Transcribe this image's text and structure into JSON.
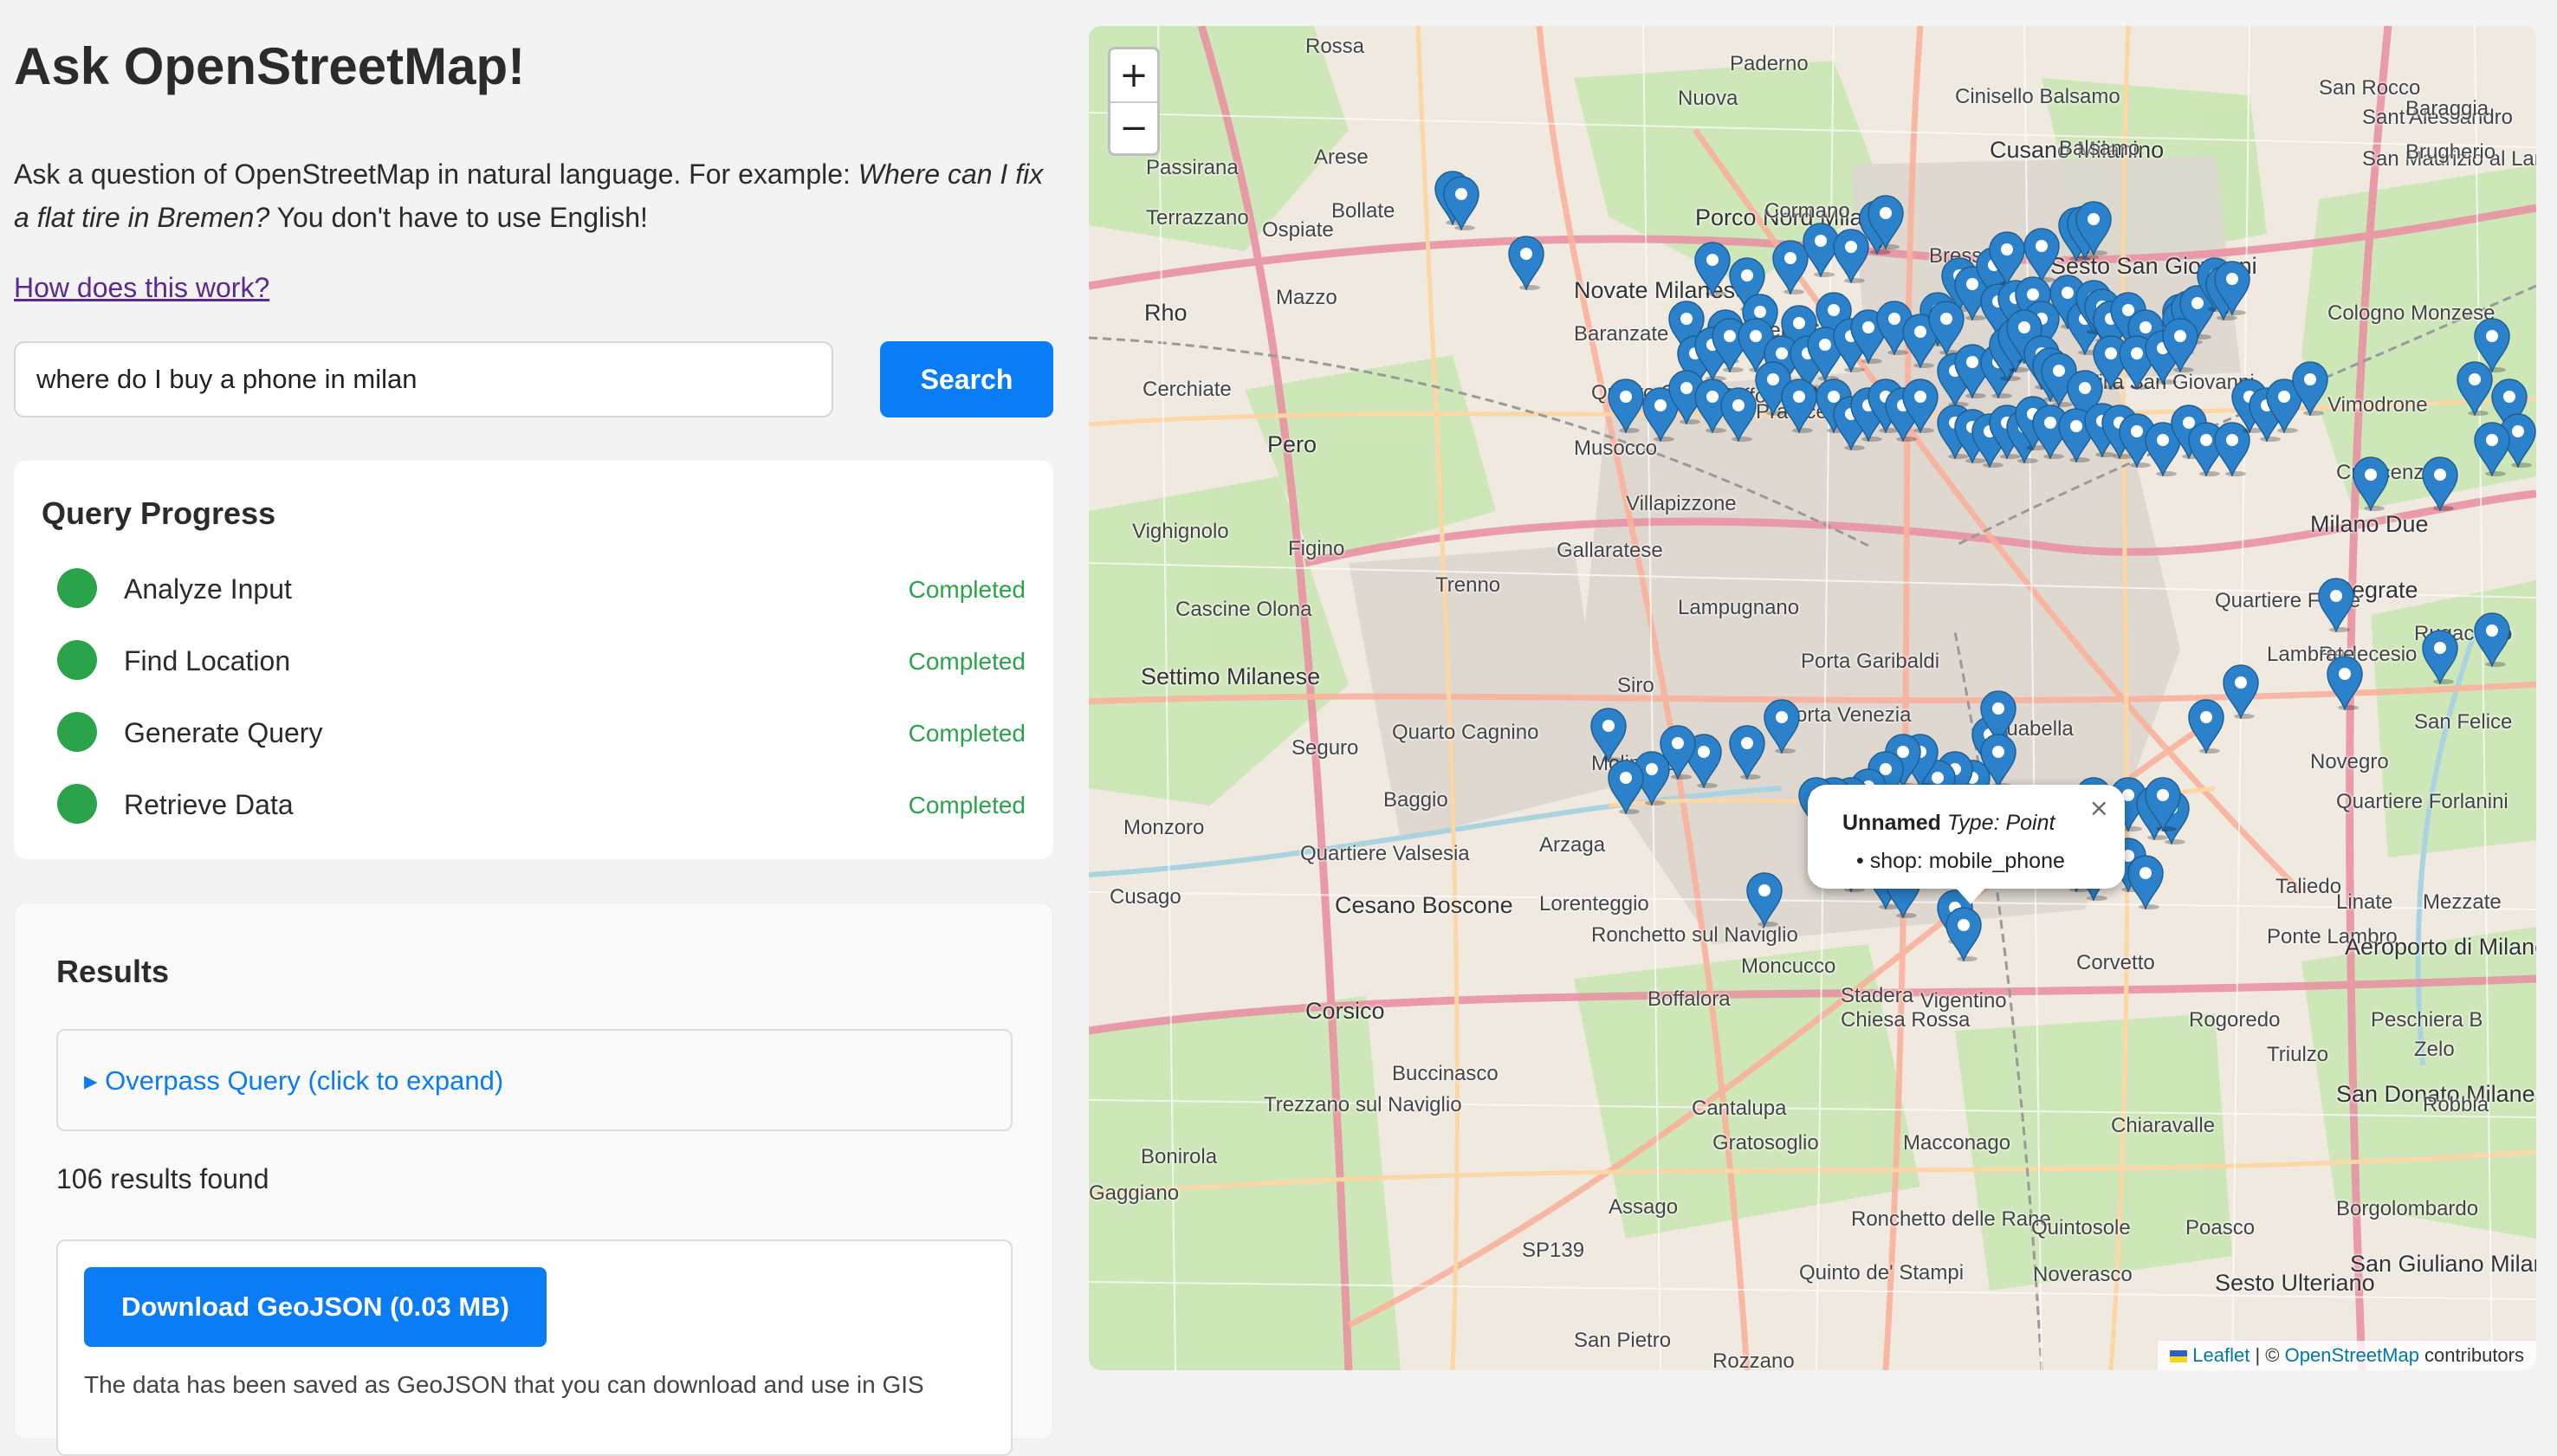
{
  "page": {
    "title": "Ask OpenStreetMap!",
    "intro_prefix": "Ask a question of OpenStreetMap in natural language. For example: ",
    "intro_example": "Where can I fix a flat tire in Bremen?",
    "intro_suffix": " You don't have to use English!",
    "how_link": "How does this work?"
  },
  "search": {
    "value": "where do I buy a phone in milan",
    "button_label": "Search"
  },
  "progress": {
    "title": "Query Progress",
    "steps": [
      {
        "label": "Analyze Input",
        "status": "Completed"
      },
      {
        "label": "Find Location",
        "status": "Completed"
      },
      {
        "label": "Generate Query",
        "status": "Completed"
      },
      {
        "label": "Retrieve Data",
        "status": "Completed"
      }
    ],
    "status_color": "#2aa34a"
  },
  "results": {
    "title": "Results",
    "overpass_toggle": "▸ Overpass Query (click to expand)",
    "count_text": "106 results found",
    "download_label": "Download GeoJSON (0.03 MB)",
    "download_note": "The data has been saved as GeoJSON that you can download and use in GIS"
  },
  "map": {
    "zoom_in": "+",
    "zoom_out": "−",
    "places": [
      "Rossa",
      "Paderno",
      "Cinisello Balsamo",
      "San Rocco",
      "Nuova",
      "Sant'Alessandro",
      "Baraggia",
      "Passirana",
      "Arese",
      "Cusano Milanino",
      "Balsamo",
      "San Maurizio al Lambro",
      "Brugherio",
      "Terrazzano",
      "Ospiate",
      "Bollate",
      "Porco Nord Milano",
      "Cormano",
      "Bresso",
      "Sesto San Giovanni",
      "Rho",
      "Mazzo",
      "Novate Milanese",
      "Baranzate",
      "Quartiere Comasina",
      "Cologno Monzese",
      "Cerchiate",
      "Quarto Oggiaro",
      "Affori",
      "Villa San Giovanni",
      "Vimodrone",
      "Pero",
      "Musocco",
      "Niguarda",
      "Pratocentenaro",
      "Vighignolo",
      "Figino",
      "Gallaratese",
      "Villapizzone",
      "Milano Due",
      "Crescenzago",
      "Cascine Olona",
      "Trenno",
      "Lampugnano",
      "Segrate",
      "Settimo Milanese",
      "Quartiere Feltre",
      "Porta Garibaldi",
      "Redecesio",
      "Rugacesio",
      "Quarto Cagnino",
      "Siro",
      "Porta Venezia",
      "Aquabella",
      "Lambrate",
      "San Felice",
      "Seguro",
      "Molinazzo",
      "Novegro",
      "Baggio",
      "Quartiere Forlanini",
      "Monzoro",
      "Arzaga",
      "Quartiere Valsesia",
      "Taliedo",
      "Cusago",
      "Cesano Boscone",
      "Lorenteggio",
      "Linate",
      "Mezzate",
      "Ronchetto sul Naviglio",
      "Ponte Lambro",
      "Aeroporto di Milano-Linate",
      "Boffalora",
      "Moncucco",
      "Corvetto",
      "Corsico",
      "Stadera",
      "Vigentino",
      "Chiesa Rossa",
      "Rogoredo",
      "Peschiera B",
      "Buccinasco",
      "Triulzo",
      "Zelo",
      "Trezzano sul Naviglio",
      "San Donato Milanese",
      "Cantalupa",
      "Chiaravalle",
      "Robbia",
      "Bonirola",
      "Gratosoglio",
      "Macconago",
      "Gaggiano",
      "Assago",
      "Ronchetto delle Rane",
      "Quintosole",
      "Poasco",
      "Borgolombardo",
      "SP139",
      "Quinto de' Stampi",
      "Noverasco",
      "Sesto Ulteriano",
      "San Giuliano Milanese",
      "San Pietro",
      "Rozzano"
    ],
    "popup": {
      "name": "Unnamed",
      "type_label": "Type: Point",
      "tag": "shop: mobile_phone",
      "close": "×"
    },
    "attribution": {
      "leaflet": "Leaflet",
      "separator": " | © ",
      "osm": "OpenStreetMap",
      "suffix": " contributors"
    },
    "marker_color": "#2b82cb"
  }
}
